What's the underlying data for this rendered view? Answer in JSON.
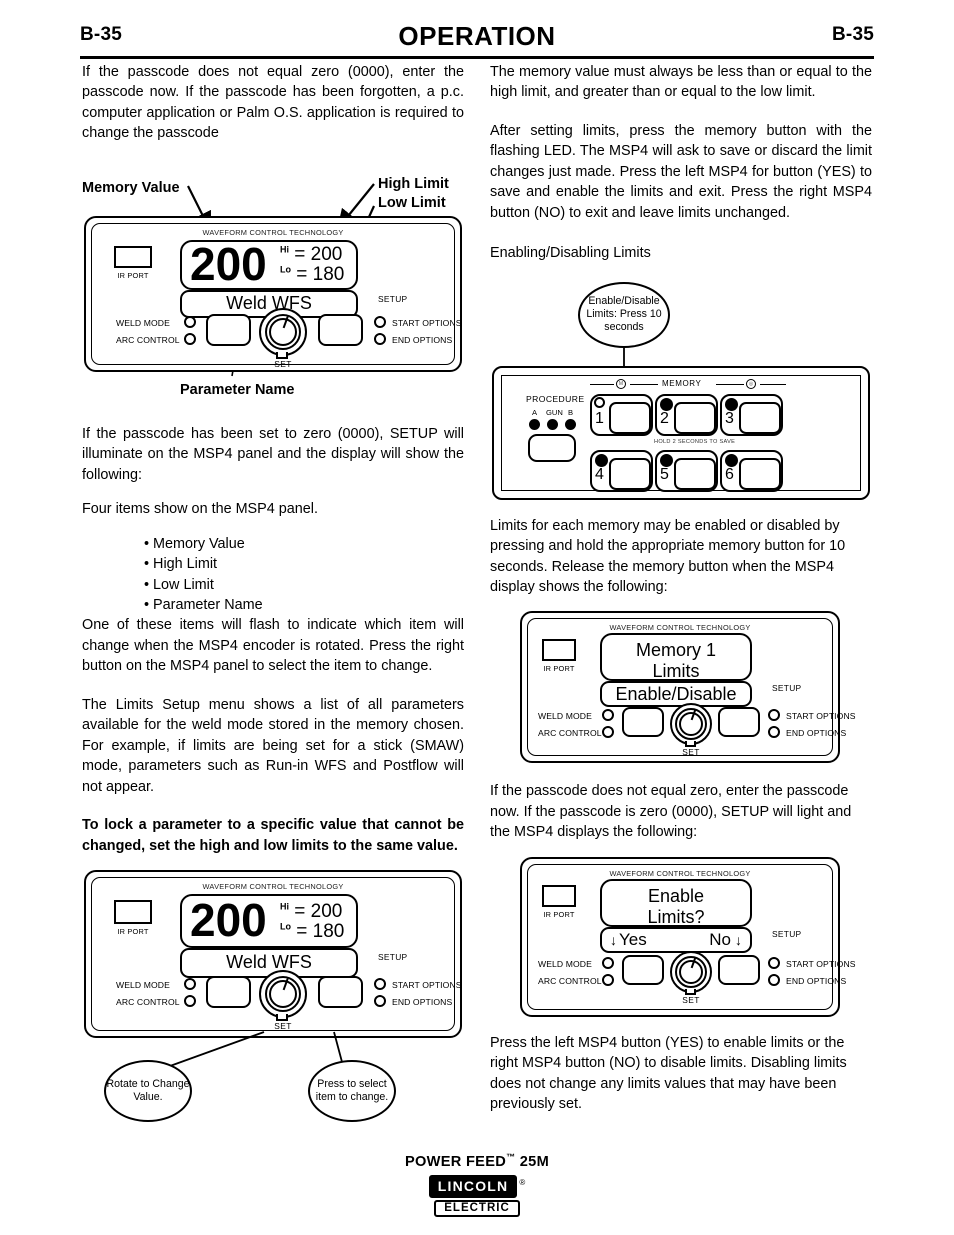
{
  "header": {
    "page_left": "B-35",
    "title": "OPERATION",
    "page_right": "B-35"
  },
  "left_column": {
    "p1": "If the passcode does not equal zero (0000), enter the passcode now.  If the passcode has been forgotten, a p.c. computer application or Palm O.S. application is required to change the passcode",
    "figure1": {
      "annotations": {
        "memory_value": "Memory Value",
        "high_limit": "High Limit",
        "low_limit": "Low Limit",
        "parameter_name": "Parameter Name"
      }
    },
    "p2": "If the passcode has been set to zero (0000), SETUP will illuminate on the MSP4 panel and the display will show the following:",
    "p3": "Four items show on the MSP4 panel.",
    "bullets": [
      "Memory Value",
      "High Limit",
      "Low Limit",
      "Parameter Name"
    ],
    "p4": "One of these items will flash to indicate which item will change when the MSP4 encoder is rotated.   Press the right button on the MSP4 panel to select the item to change.",
    "p5": "The Limits Setup menu shows a list of all parameters available for the weld mode stored in the memory chosen.  For example, if limits are being set for a stick (SMAW) mode, parameters such as Run-in WFS and Postflow will not appear.",
    "p6": "To lock a parameter to a specific value that cannot be changed, set the high and low limits to the same value.",
    "callouts": {
      "rotate": "Rotate to Change Value.",
      "press": "Press to select item to change."
    }
  },
  "right_column": {
    "p1": "The memory value must always be less than or equal to the high limit, and greater than or equal to the low limit.",
    "p2": "After setting limits, press the memory button with the flashing LED.  The MSP4 will ask to save or discard the limit changes just made.  Press the left MSP4 for button (YES) to save and enable the limits and exit.  Press the right MSP4 button (NO) to exit and leave limits unchanged.",
    "p3": "Enabling/Disabling Limits",
    "callout_enable_disable": "Enable/Disable Limits: Press 10 seconds",
    "p4": "Limits for each memory may be enabled or disabled by pressing and hold the appropriate memory button for 10 seconds.  Release the memory button when the MSP4 display shows the following:",
    "p5": "If the passcode does not equal zero, enter the passcode now.   If the passcode is zero (0000), SETUP will light and the MSP4 displays the following:",
    "p6": "Press the left MSP4 button (YES) to enable limits or the right MSP4 button (NO) to disable limits. Disabling limits does not change any limits values that may have been previously set."
  },
  "msp4_panel": {
    "wct_label": "WAVEFORM CONTROL TECHNOLOGY",
    "ir_port_label": "IR PORT",
    "setup_label": "SETUP",
    "weld_mode_label": "WELD MODE",
    "arc_control_label": "ARC CONTROL",
    "start_options_label": "START OPTIONS",
    "end_options_label": "END OPTIONS",
    "set_label": "SET"
  },
  "display_limits": {
    "main_value": "200",
    "hi_tag": "Hi",
    "lo_tag": "Lo",
    "equals": "=",
    "hi_value": "200",
    "lo_value": "180",
    "parameter": "Weld WFS"
  },
  "display_memory_limits": {
    "line1": "Memory  1",
    "line2": "Limits",
    "sub": "Enable/Disable"
  },
  "display_enable_limits": {
    "line1": "Enable",
    "line2": "Limits?",
    "yes": "Yes",
    "no": "No",
    "arrow": "↓"
  },
  "memory_panel": {
    "memory_label": "MEMORY",
    "procedure_label": "PROCEDURE",
    "proc_a": "A",
    "proc_gun": "GUN",
    "proc_b": "B",
    "hold_note": "HOLD 2 SECONDS TO SAVE",
    "buttons": [
      "1",
      "2",
      "3",
      "4",
      "5",
      "6"
    ],
    "left_icon": "M",
    "right_icon": "◎"
  },
  "footer": {
    "model": "POWER FEED",
    "tm": "™",
    "model_suffix": "25M",
    "logo_top": "LINCOLN",
    "logo_reg": "®",
    "logo_bottom": "ELECTRIC"
  }
}
